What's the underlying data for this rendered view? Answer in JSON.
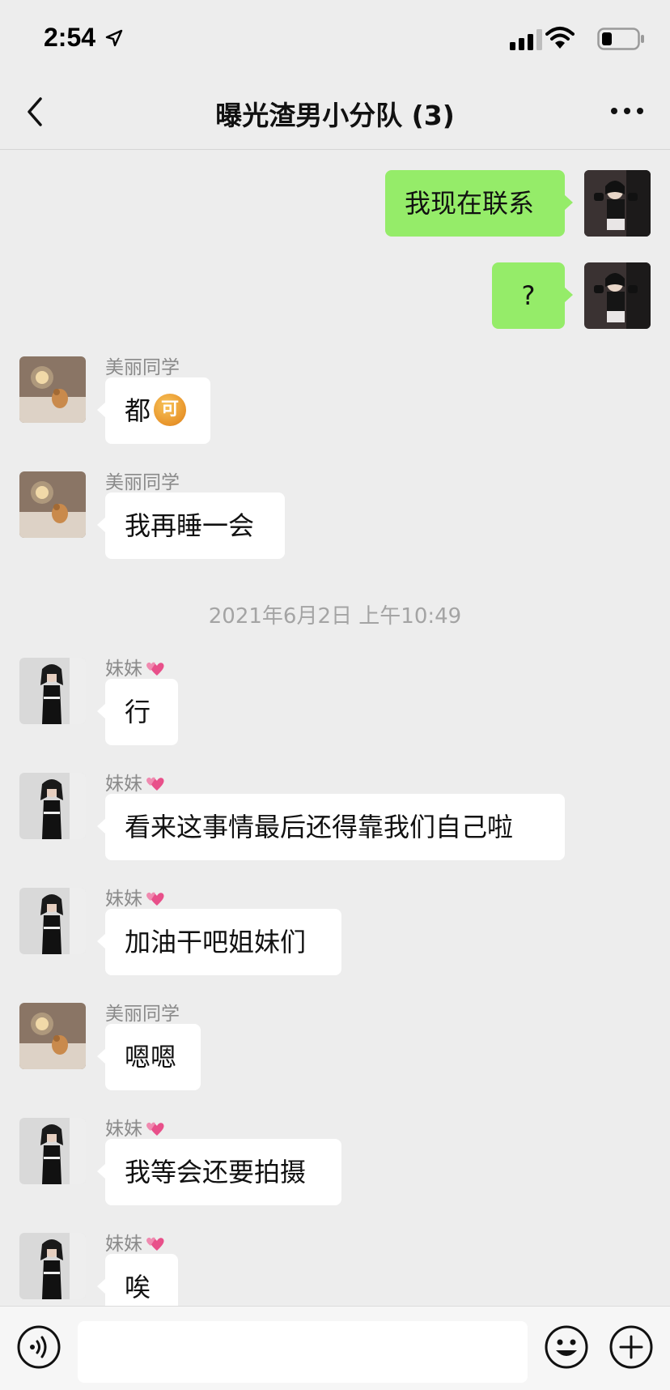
{
  "status_bar": {
    "time": "2:54"
  },
  "nav": {
    "title": "曝光渣男小分队 (3)"
  },
  "messages": [
    {
      "sender": "",
      "outgoing": true,
      "text": "我现在联系"
    },
    {
      "sender": "",
      "outgoing": true,
      "text": "?"
    },
    {
      "sender": "美丽同学",
      "outgoing": false,
      "text": "都",
      "emoji": "可"
    },
    {
      "sender": "美丽同学",
      "outgoing": false,
      "text": "我再睡一会"
    },
    {
      "sender": "妹妹",
      "outgoing": false,
      "text": "行"
    },
    {
      "sender": "妹妹",
      "outgoing": false,
      "text": "看来这事情最后还得靠我们自己啦"
    },
    {
      "sender": "妹妹",
      "outgoing": false,
      "text": "加油干吧姐妹们"
    },
    {
      "sender": "美丽同学",
      "outgoing": false,
      "text": "嗯嗯"
    },
    {
      "sender": "妹妹",
      "outgoing": false,
      "text": "我等会还要拍摄"
    },
    {
      "sender": "妹妹",
      "outgoing": false,
      "text": "唉"
    }
  ],
  "timestamp": "2021年6月2日 上午10:49",
  "colors": {
    "background": "#ededed",
    "outgoing_bubble": "#95ec69",
    "incoming_bubble": "#ffffff",
    "heart": "#e8508a"
  },
  "icons": {
    "back": "chevron-left-icon",
    "more": "ellipsis-icon",
    "voice": "voice-icon",
    "emoji": "smiley-icon",
    "plus": "plus-circle-icon",
    "heart": "heart-icon"
  },
  "input": {
    "value": "",
    "placeholder": ""
  }
}
